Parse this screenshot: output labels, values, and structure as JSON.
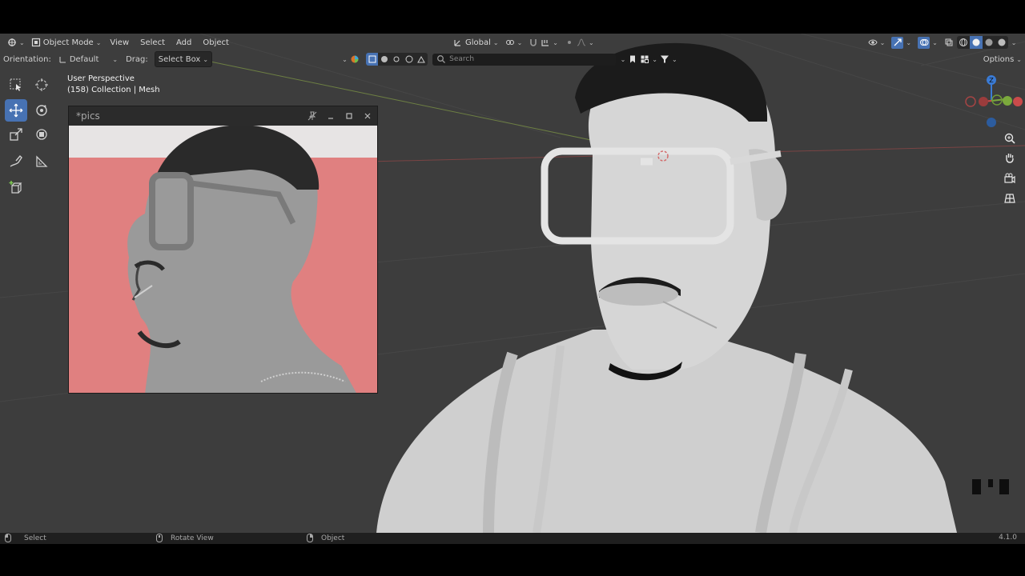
{
  "header": {
    "mode_label": "Object Mode",
    "menus": [
      "View",
      "Select",
      "Add",
      "Object"
    ],
    "transform_orientation": "Global",
    "icons": [
      "editor-type-icon",
      "object-mode-icon",
      "pivot-icon",
      "snap-icon",
      "proportional-icon"
    ]
  },
  "tool_settings": {
    "orientation_label": "Orientation:",
    "orientation_value": "Default",
    "drag_label": "Drag:",
    "drag_value": "Select Box",
    "search_placeholder": "Search",
    "options_label": "Options"
  },
  "viewport": {
    "perspective_label": "User Perspective",
    "collection_label": "(158) Collection | Mesh",
    "axes": {
      "z": "Z"
    },
    "colors": {
      "background": "#3d3d3d",
      "x_axis": "#c94b4b",
      "y_axis": "#7ba93c",
      "z_axis": "#3a7bd5",
      "active_tool": "#4772b3"
    }
  },
  "image_window": {
    "title": "*pics",
    "colors": {
      "backdrop": "#e08080",
      "top_band": "#e7e4e4"
    }
  },
  "status_bar": {
    "left_action": "Select",
    "middle_action": "Rotate View",
    "right_action": "Object",
    "version": "4.1.0"
  }
}
